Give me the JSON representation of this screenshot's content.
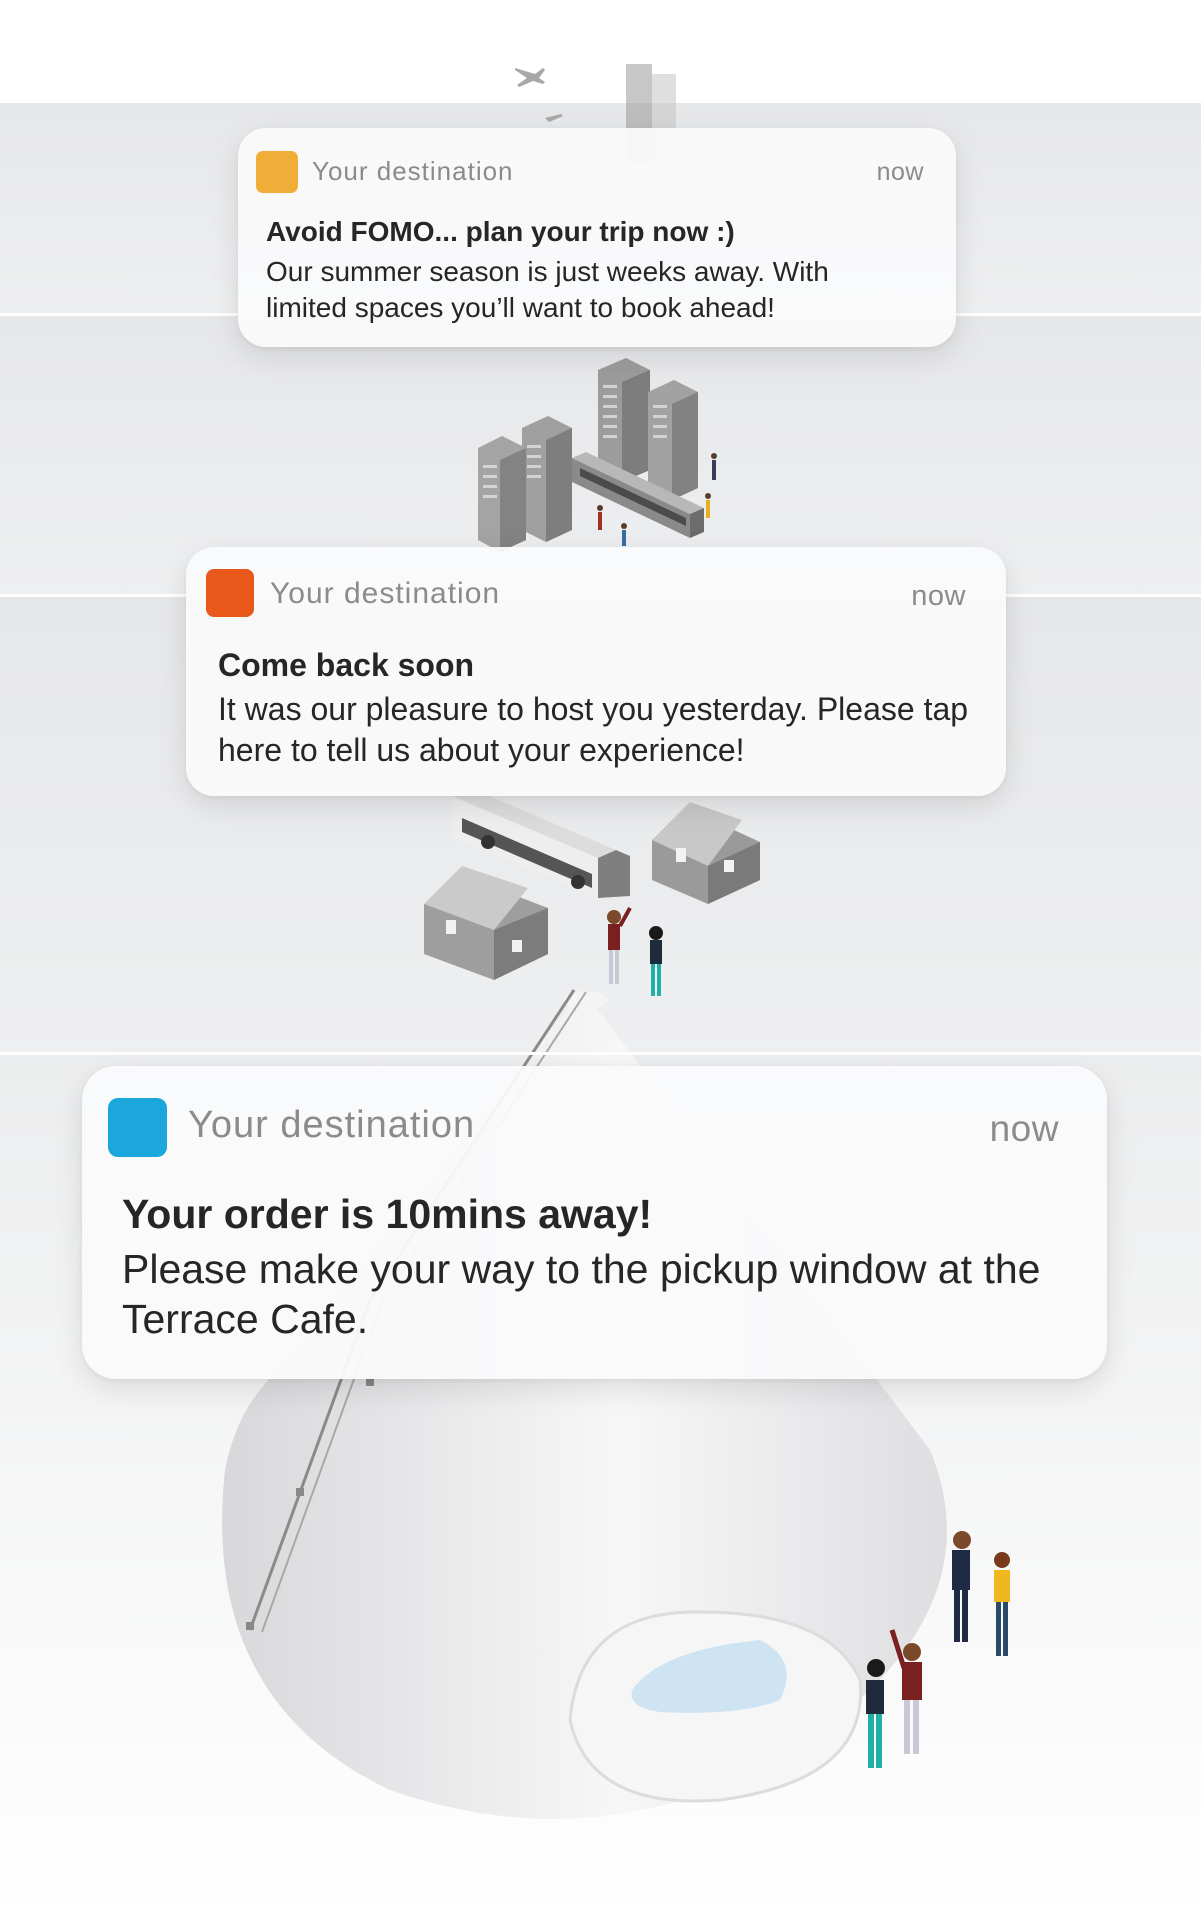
{
  "notifications": [
    {
      "app_name": "Your destination",
      "time": "now",
      "title": "Avoid FOMO... plan your trip now :)",
      "body": "Our summer season is just weeks away. With limited spaces you’ll want to book ahead!",
      "icon_color": "#f0ad38"
    },
    {
      "app_name": "Your destination",
      "time": "now",
      "title": "Come back soon",
      "body": "It was our pleasure to host you yesterday. Please tap here to tell us about your experience!",
      "icon_color": "#e9581b"
    },
    {
      "app_name": "Your destination",
      "time": "now",
      "title": "Your order is 10mins away!",
      "body": "Please make your way to the pickup window at the Terrace Cafe.",
      "icon_color": "#1ba6dc"
    }
  ],
  "colors": {
    "band": "#e8e9eb",
    "building": "#8e8e8e",
    "cone": "#f0f0f2",
    "pool": "#cfe4f2"
  },
  "illustration": {
    "items": [
      "city-skyline",
      "tram",
      "bus",
      "houses",
      "people",
      "mountain-cone",
      "pool"
    ]
  }
}
